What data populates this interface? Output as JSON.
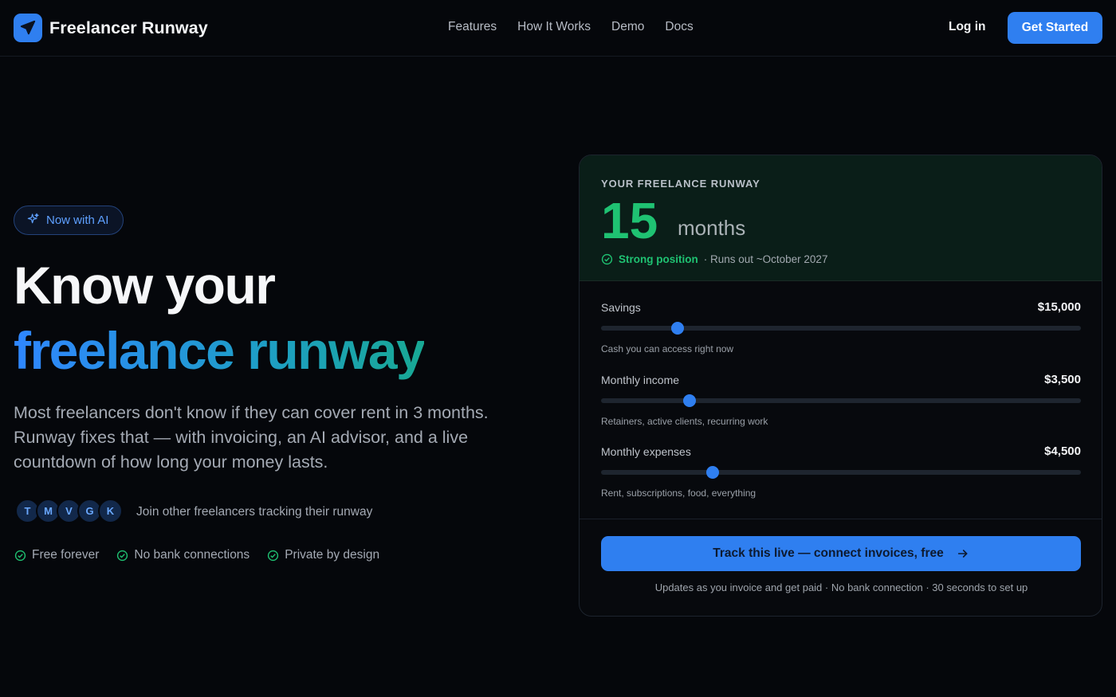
{
  "header": {
    "brand": "Freelancer Runway",
    "logo_icon": "airplane-icon",
    "nav": [
      "Features",
      "How It Works",
      "Demo",
      "Docs"
    ],
    "login": "Log in",
    "cta": "Get Started"
  },
  "hero": {
    "badge": "Now with AI",
    "badge_icon": "sparkle-icon",
    "title_line1": "Know your",
    "title_line2": "freelance runway",
    "lead": "Most freelancers don't know if they can cover rent in 3 months. Runway fixes that — with invoicing, an AI advisor, and a live countdown of how long your money lasts.",
    "avatars": [
      "T",
      "M",
      "V",
      "G",
      "K"
    ],
    "join_text": "Join other freelancers tracking their runway",
    "perks": [
      "Free forever",
      "No bank connections",
      "Private by design"
    ]
  },
  "card": {
    "label": "YOUR FREELANCE RUNWAY",
    "months_value": "15",
    "months_unit": "months",
    "status": "Strong position",
    "runs_out": "· Runs out ~October 2027",
    "sliders": [
      {
        "label": "Savings",
        "value": "$15,000",
        "hint": "Cash you can access right now",
        "position": 0.16
      },
      {
        "label": "Monthly income",
        "value": "$3,500",
        "hint": "Retainers, active clients, recurring work",
        "position": 0.184
      },
      {
        "label": "Monthly expenses",
        "value": "$4,500",
        "hint": "Rent, subscriptions, food, everything",
        "position": 0.233
      }
    ],
    "cta": "Track this live — connect invoices, free",
    "footer": "Updates as you invoice and get paid · No bank connection · 30 seconds to set up"
  },
  "colors": {
    "accent": "#2f7ff0",
    "success": "#1fc272",
    "background": "#05070b"
  }
}
